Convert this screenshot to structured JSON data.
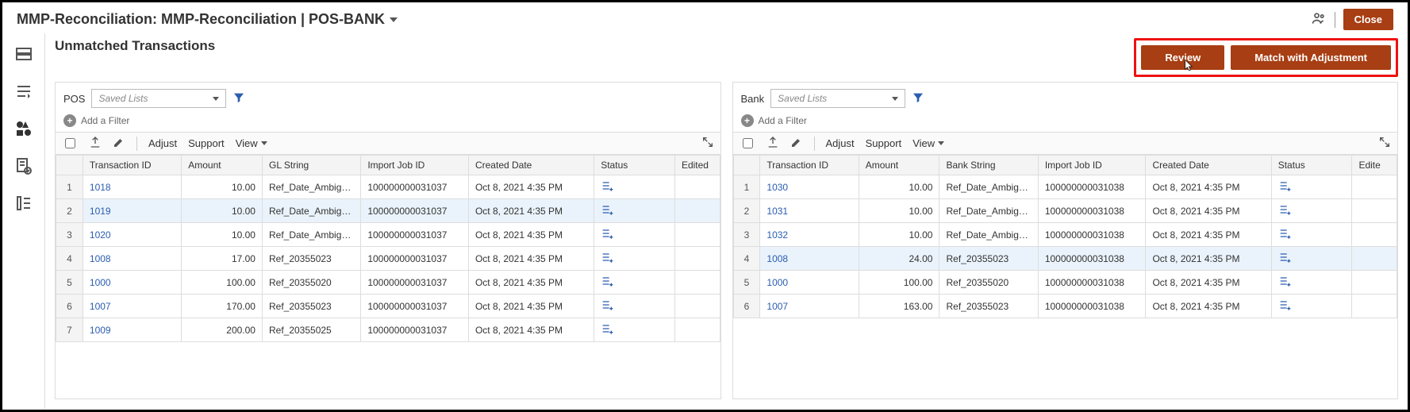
{
  "header": {
    "title": "MMP-Reconciliation: MMP-Reconciliation | POS-BANK",
    "close": "Close"
  },
  "section_title": "Unmatched Transactions",
  "buttons": {
    "review": "Review",
    "match_adj": "Match with Adjustment"
  },
  "rail": {
    "items": [
      "overview",
      "flash",
      "shapes",
      "doc-check",
      "list"
    ]
  },
  "left": {
    "label": "POS",
    "saved": "Saved Lists",
    "add_filter": "Add a Filter",
    "toolbar": {
      "adjust": "Adjust",
      "support": "Support",
      "view": "View"
    },
    "cols": {
      "tid": "Transaction ID",
      "amount": "Amount",
      "gl": "GL String",
      "job": "Import Job ID",
      "created": "Created Date",
      "status": "Status",
      "edited": "Edited"
    },
    "rows": [
      {
        "n": "1",
        "tid": "1018",
        "amount": "10.00",
        "gl": "Ref_Date_Ambiguou",
        "job": "100000000031037",
        "created": "Oct 8, 2021 4:35 PM"
      },
      {
        "n": "2",
        "tid": "1019",
        "amount": "10.00",
        "gl": "Ref_Date_Ambiguou",
        "job": "100000000031037",
        "created": "Oct 8, 2021 4:35 PM",
        "sel": true
      },
      {
        "n": "3",
        "tid": "1020",
        "amount": "10.00",
        "gl": "Ref_Date_Ambiguou",
        "job": "100000000031037",
        "created": "Oct 8, 2021 4:35 PM"
      },
      {
        "n": "4",
        "tid": "1008",
        "amount": "17.00",
        "gl": "Ref_20355023",
        "job": "100000000031037",
        "created": "Oct 8, 2021 4:35 PM"
      },
      {
        "n": "5",
        "tid": "1000",
        "amount": "100.00",
        "gl": "Ref_20355020",
        "job": "100000000031037",
        "created": "Oct 8, 2021 4:35 PM"
      },
      {
        "n": "6",
        "tid": "1007",
        "amount": "170.00",
        "gl": "Ref_20355023",
        "job": "100000000031037",
        "created": "Oct 8, 2021 4:35 PM"
      },
      {
        "n": "7",
        "tid": "1009",
        "amount": "200.00",
        "gl": "Ref_20355025",
        "job": "100000000031037",
        "created": "Oct 8, 2021 4:35 PM"
      }
    ]
  },
  "right": {
    "label": "Bank",
    "saved": "Saved Lists",
    "add_filter": "Add a Filter",
    "toolbar": {
      "adjust": "Adjust",
      "support": "Support",
      "view": "View"
    },
    "cols": {
      "tid": "Transaction ID",
      "amount": "Amount",
      "bank": "Bank String",
      "job": "Import Job ID",
      "created": "Created Date",
      "status": "Status",
      "edited": "Edite"
    },
    "rows": [
      {
        "n": "1",
        "tid": "1030",
        "amount": "10.00",
        "bank": "Ref_Date_Ambiguou",
        "job": "100000000031038",
        "created": "Oct 8, 2021 4:35 PM"
      },
      {
        "n": "2",
        "tid": "1031",
        "amount": "10.00",
        "bank": "Ref_Date_Ambiguou",
        "job": "100000000031038",
        "created": "Oct 8, 2021 4:35 PM"
      },
      {
        "n": "3",
        "tid": "1032",
        "amount": "10.00",
        "bank": "Ref_Date_Ambiguou",
        "job": "100000000031038",
        "created": "Oct 8, 2021 4:35 PM"
      },
      {
        "n": "4",
        "tid": "1008",
        "amount": "24.00",
        "bank": "Ref_20355023",
        "job": "100000000031038",
        "created": "Oct 8, 2021 4:35 PM",
        "sel": true
      },
      {
        "n": "5",
        "tid": "1000",
        "amount": "100.00",
        "bank": "Ref_20355020",
        "job": "100000000031038",
        "created": "Oct 8, 2021 4:35 PM"
      },
      {
        "n": "6",
        "tid": "1007",
        "amount": "163.00",
        "bank": "Ref_20355023",
        "job": "100000000031038",
        "created": "Oct 8, 2021 4:35 PM"
      }
    ]
  }
}
